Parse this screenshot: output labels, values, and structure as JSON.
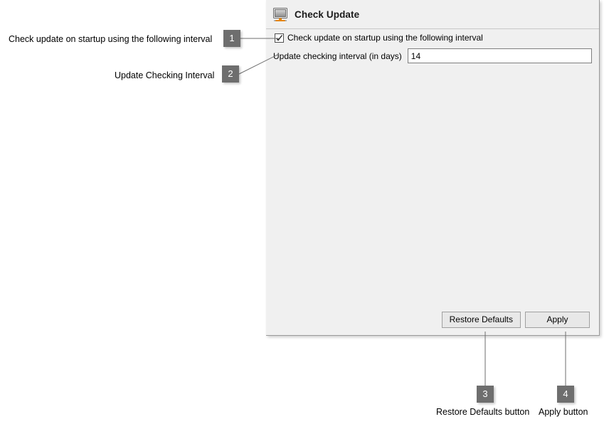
{
  "panel": {
    "header": {
      "icon": "monitor-icon",
      "title": "Check Update"
    },
    "checkbox": {
      "label": "Check update on startup using the following interval",
      "checked": true,
      "icon": "checkmark-icon"
    },
    "interval": {
      "label": "Update checking interval (in days)",
      "value": "14",
      "placeholder": ""
    },
    "buttons": {
      "restore_defaults": "Restore Defaults",
      "apply": "Apply"
    }
  },
  "callouts": [
    {
      "number": "1",
      "label": "Check update on startup using the following interval"
    },
    {
      "number": "2",
      "label": "Update Checking Interval"
    },
    {
      "number": "3",
      "label": "Restore Defaults button"
    },
    {
      "number": "4",
      "label": "Apply button"
    }
  ],
  "colors": {
    "badge_background": "#6e6e6e",
    "badge_text": "#ffffff",
    "panel_background": "#f0f0f0",
    "leader_line": "#6e6e6e",
    "icon_accent": "#e8860c"
  }
}
